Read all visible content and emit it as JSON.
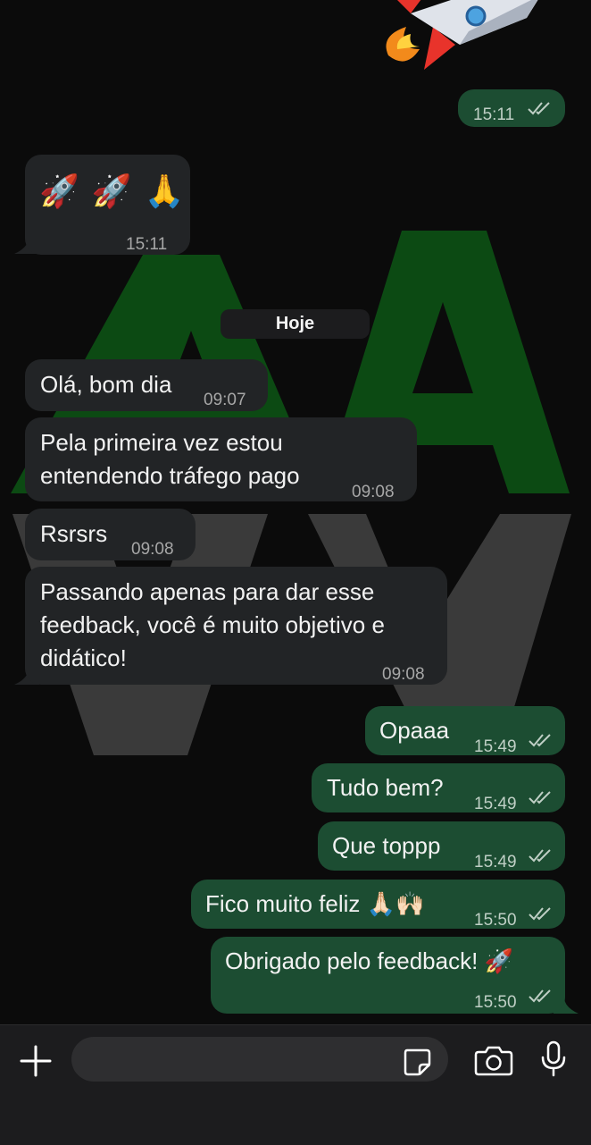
{
  "messages": [
    {
      "time": "15:11"
    },
    {
      "emoji": "🚀 🚀 🙏",
      "time": "15:11"
    },
    {
      "text": "Olá, bom dia",
      "time": "09:07"
    },
    {
      "line1": "Pela primeira vez estou",
      "line2": "entendendo tráfego pago",
      "time": "09:08"
    },
    {
      "text": "Rsrsrs",
      "time": "09:08"
    },
    {
      "line1": "Passando apenas para dar esse",
      "line2": "feedback, você é muito objetivo e",
      "line3": "didático!",
      "time": "09:08"
    },
    {
      "text": "Opaaa",
      "time": "15:49"
    },
    {
      "text": "Tudo bem?",
      "time": "15:49"
    },
    {
      "text": "Que toppp",
      "time": "15:49"
    },
    {
      "text": "Fico muito feliz 🙏🏻🙌🏻",
      "time": "15:50"
    },
    {
      "text": "Obrigado pelo feedback! 🚀",
      "time": "15:50"
    }
  ],
  "date_divider": "Hoje",
  "top_sticker": "rocket-sticker",
  "colors": {
    "background": "#0b0b0b",
    "incoming_bubble": "#222426",
    "outgoing_bubble": "#1c4d32",
    "watermark_green": "#0c4a13",
    "watermark_gray": "#3a3a3a",
    "input_bar": "#1c1c1e"
  },
  "input_bar": {
    "icons": [
      "plus-icon",
      "sticker-icon",
      "camera-icon",
      "microphone-icon"
    ]
  }
}
